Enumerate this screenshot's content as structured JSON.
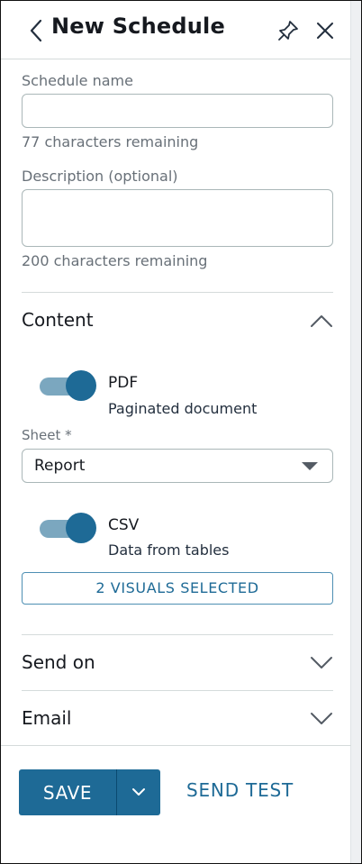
{
  "header": {
    "title": "New Schedule",
    "back_icon": "chevron-left-icon",
    "pin_icon": "pin-icon",
    "close_icon": "close-icon"
  },
  "form": {
    "schedule_name": {
      "label": "Schedule name",
      "value": "",
      "hint": "77 characters remaining"
    },
    "description": {
      "label": "Description (optional)",
      "value": "",
      "hint": "200 characters remaining"
    }
  },
  "content": {
    "title": "Content",
    "expanded": true,
    "pdf": {
      "enabled": true,
      "title": "PDF",
      "description": "Paginated document"
    },
    "sheet": {
      "label": "Sheet *",
      "selected": "Report"
    },
    "csv": {
      "enabled": true,
      "title": "CSV",
      "description": "Data from tables"
    },
    "visuals_button": "2 VISUALS SELECTED"
  },
  "send_on": {
    "title": "Send on",
    "expanded": false
  },
  "email": {
    "title": "Email",
    "expanded": false
  },
  "footer": {
    "save_label": "SAVE",
    "send_test_label": "SEND TEST"
  },
  "colors": {
    "primary": "#1e6a96",
    "toggle_track": "#7ba7bf",
    "text": "#16191f",
    "muted": "#687078",
    "border": "#aab7b8"
  }
}
